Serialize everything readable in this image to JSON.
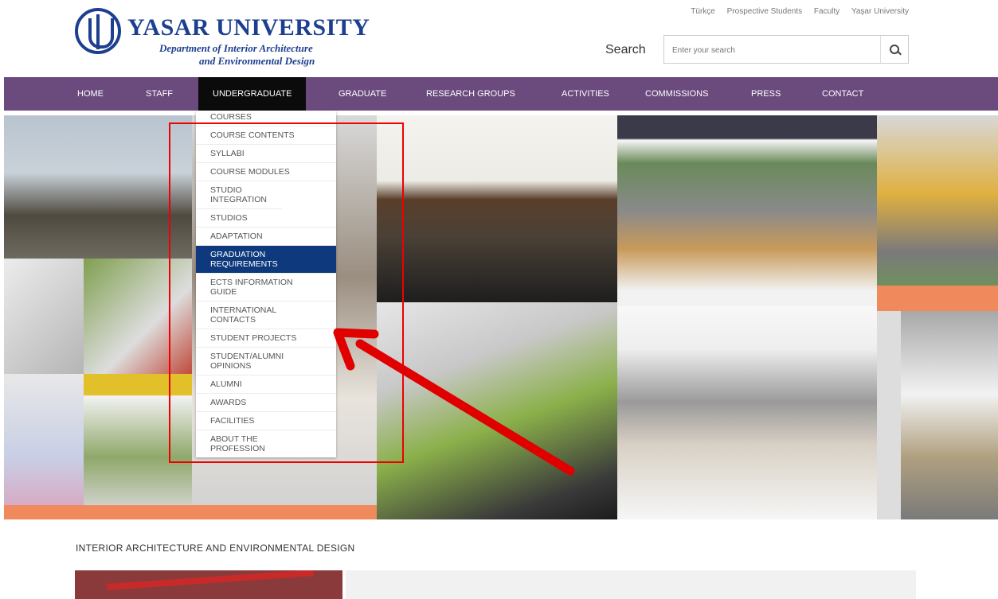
{
  "header": {
    "logo_name": "YASAR UNIVERSITY",
    "logo_dept_line1": "Department of Interior Architecture",
    "logo_dept_line2": "and Environmental Design",
    "top_links": [
      "Türkçe",
      "Prospective Students",
      "Faculty",
      "Yaşar University"
    ],
    "search_label": "Search",
    "search_placeholder": "Enter your search"
  },
  "nav": {
    "items": [
      "HOME",
      "STAFF",
      "UNDERGRADUATE",
      "GRADUATE",
      "RESEARCH GROUPS",
      "ACTIVITIES",
      "COMMISSIONS",
      "PRESS",
      "CONTACT"
    ],
    "active": "UNDERGRADUATE"
  },
  "dropdown": {
    "items": [
      {
        "label": "COURSES"
      },
      {
        "label": "COURSE CONTENTS"
      },
      {
        "label": "SYLLABI"
      },
      {
        "label": "COURSE MODULES"
      },
      {
        "label": "STUDIO INTEGRATION"
      },
      {
        "label": "STUDIOS"
      },
      {
        "label": "ADAPTATION"
      },
      {
        "label": "GRADUATION REQUIREMENTS",
        "selected": true
      },
      {
        "label": "ECTS INFORMATION GUIDE"
      },
      {
        "label": "INTERNATIONAL CONTACTS"
      },
      {
        "label": "STUDENT PROJECTS"
      },
      {
        "label": "STUDENT/ALUMNI OPINIONS"
      },
      {
        "label": "ALUMNI"
      },
      {
        "label": "AWARDS"
      },
      {
        "label": "FACILITIES"
      },
      {
        "label": "ABOUT THE PROFESSION"
      }
    ]
  },
  "main": {
    "section_title": "INTERIOR ARCHITECTURE AND ENVIRONMENTAL DESIGN"
  },
  "colors": {
    "nav_bg": "#6b4a7e",
    "nav_active": "#0b0b0b",
    "brand_blue": "#1d3f8f",
    "dropdown_selected": "#0e3a7d",
    "annotation_red": "#e00000"
  },
  "icons": {
    "search": "search-icon",
    "logo": "university-logo-icon"
  }
}
